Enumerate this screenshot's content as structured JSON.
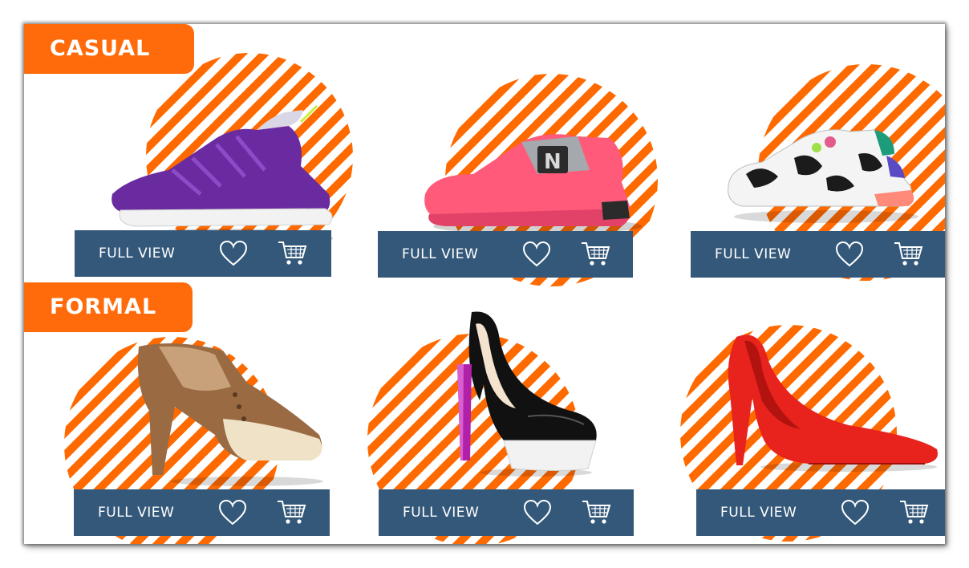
{
  "categories": {
    "casual": {
      "label": "CASUAL"
    },
    "formal": {
      "label": "FORMAL"
    }
  },
  "products": {
    "casual": [
      {
        "name": "purple-knit-sneaker",
        "action_label": "FULL VIEW"
      },
      {
        "name": "pink-new-balance-sneaker",
        "action_label": "FULL VIEW",
        "logo_letter": "N"
      },
      {
        "name": "white-chunky-sneaker",
        "action_label": "FULL VIEW"
      }
    ],
    "formal": [
      {
        "name": "brown-oxford-heel",
        "action_label": "FULL VIEW"
      },
      {
        "name": "black-patent-platform-pump",
        "action_label": "FULL VIEW"
      },
      {
        "name": "red-suede-stiletto",
        "action_label": "FULL VIEW"
      }
    ]
  },
  "icons": {
    "heart": "heart-icon",
    "cart": "cart-icon"
  },
  "colors": {
    "accent": "#ff6b0a",
    "bar": "#34587a",
    "stripe": "#ff6a00",
    "text_on_dark": "#ffffff"
  }
}
